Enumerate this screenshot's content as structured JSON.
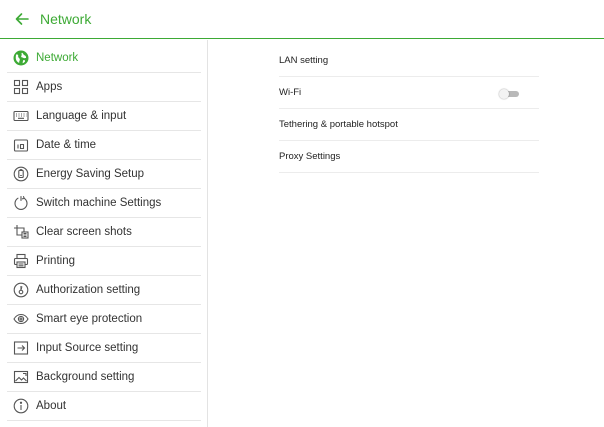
{
  "header": {
    "title": "Network",
    "back_icon": "back-arrow-icon",
    "accent_color": "#3daa35"
  },
  "sidebar": {
    "items": [
      {
        "label": "Network",
        "icon": "globe-icon",
        "active": true
      },
      {
        "label": "Apps",
        "icon": "apps-grid-icon"
      },
      {
        "label": "Language & input",
        "icon": "keyboard-icon"
      },
      {
        "label": "Date & time",
        "icon": "calendar-icon"
      },
      {
        "label": "Energy Saving Setup",
        "icon": "energy-saving-icon"
      },
      {
        "label": "Switch machine Settings",
        "icon": "power-cycle-icon"
      },
      {
        "label": "Clear screen shots",
        "icon": "clear-screenshot-icon"
      },
      {
        "label": "Printing",
        "icon": "printer-icon"
      },
      {
        "label": "Authorization setting",
        "icon": "authorization-icon"
      },
      {
        "label": "Smart eye protection",
        "icon": "eye-icon"
      },
      {
        "label": "Input Source setting",
        "icon": "input-source-icon"
      },
      {
        "label": "Background setting",
        "icon": "image-icon"
      },
      {
        "label": "About",
        "icon": "info-icon"
      }
    ]
  },
  "main": {
    "rows": [
      {
        "label": "LAN setting"
      },
      {
        "label": "Wi-Fi",
        "toggle": "off"
      },
      {
        "label": "Tethering & portable hotspot"
      },
      {
        "label": "Proxy Settings"
      }
    ]
  }
}
